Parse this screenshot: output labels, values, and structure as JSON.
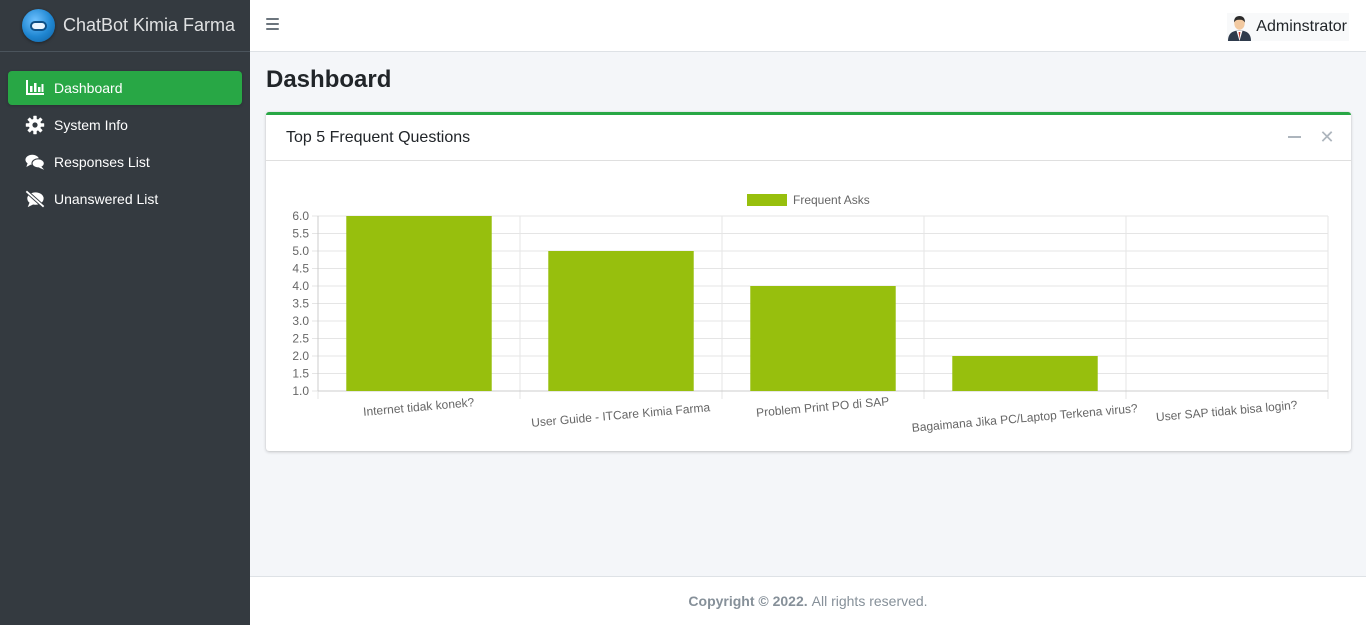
{
  "brand": {
    "name": "ChatBot Kimia Farma"
  },
  "sidebar": {
    "items": [
      {
        "label": "Dashboard",
        "icon": "bar-chart-icon",
        "active": true
      },
      {
        "label": "System Info",
        "icon": "gear-icon",
        "active": false
      },
      {
        "label": "Responses List",
        "icon": "comments-icon",
        "active": false
      },
      {
        "label": "Unanswered List",
        "icon": "comment-slash-icon",
        "active": false
      }
    ]
  },
  "header": {
    "user_name": "Adminstrator"
  },
  "page": {
    "title": "Dashboard"
  },
  "card": {
    "title": "Top 5 Frequent Questions"
  },
  "colors": {
    "accent": "#28a745",
    "sidebar": "#343a40",
    "bar": "#97bf0d"
  },
  "chart_data": {
    "type": "bar",
    "categories": [
      "Internet tidak konek?",
      "User Guide - ITCare Kimia Farma",
      "Problem Print PO di SAP",
      "Bagaimana Jika PC/Laptop Terkena virus?",
      "User SAP tidak bisa login?"
    ],
    "series": [
      {
        "name": "Frequent Asks",
        "values": [
          6,
          5,
          4,
          2,
          1
        ]
      }
    ],
    "ylim": [
      1.0,
      6.0
    ],
    "yticks": [
      "6.0",
      "5.5",
      "5.0",
      "4.5",
      "4.0",
      "3.5",
      "3.0",
      "2.5",
      "2.0",
      "1.5",
      "1.0"
    ],
    "grid": true,
    "legend": "top-center"
  },
  "footer": {
    "copyright": "Copyright © 2022.",
    "rights": "All rights reserved."
  }
}
